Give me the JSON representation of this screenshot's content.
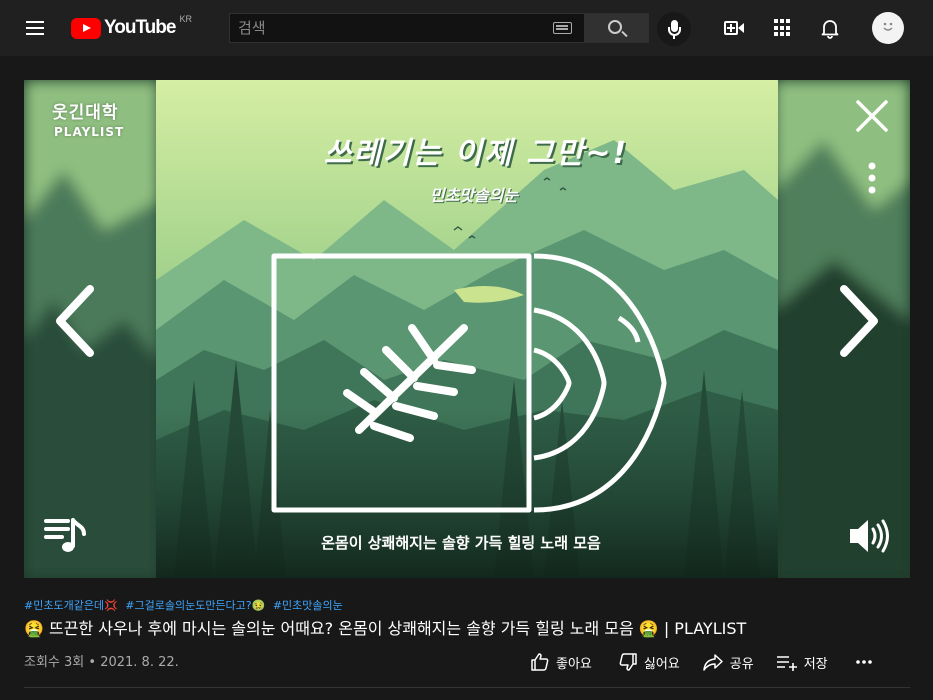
{
  "header": {
    "logo_text": "YouTube",
    "country_code": "KR",
    "search_placeholder": "검색"
  },
  "player": {
    "channel_name": "웃긴대학",
    "channel_subtitle": "PLAYLIST",
    "headline": "쓰레기는 이제 그만~!",
    "tag": "민초맛솔의눈",
    "caption": "온몸이 상쾌해지는 솔향 가득 힐링 노래 모음"
  },
  "video": {
    "hashtags": [
      "#민초도개같은데💢",
      "#그걸로솔의눈도만든다고?🤢",
      "#민초맛솔의눈"
    ],
    "title": "🤮 뜨끈한 사우나 후에 마시는 솔의눈 어때요? 온몸이 상쾌해지는 솔향 가득 힐링 노래 모음 🤮 | PLAYLIST",
    "views": "조회수 3회",
    "date": "2021. 8. 22."
  },
  "actions": {
    "like": "좋아요",
    "dislike": "싫어요",
    "share": "공유",
    "save": "저장"
  },
  "colors": {
    "brand_red": "#ff0000",
    "background": "#181818",
    "header_bg": "#202020",
    "link_blue": "#3ea6ff"
  }
}
